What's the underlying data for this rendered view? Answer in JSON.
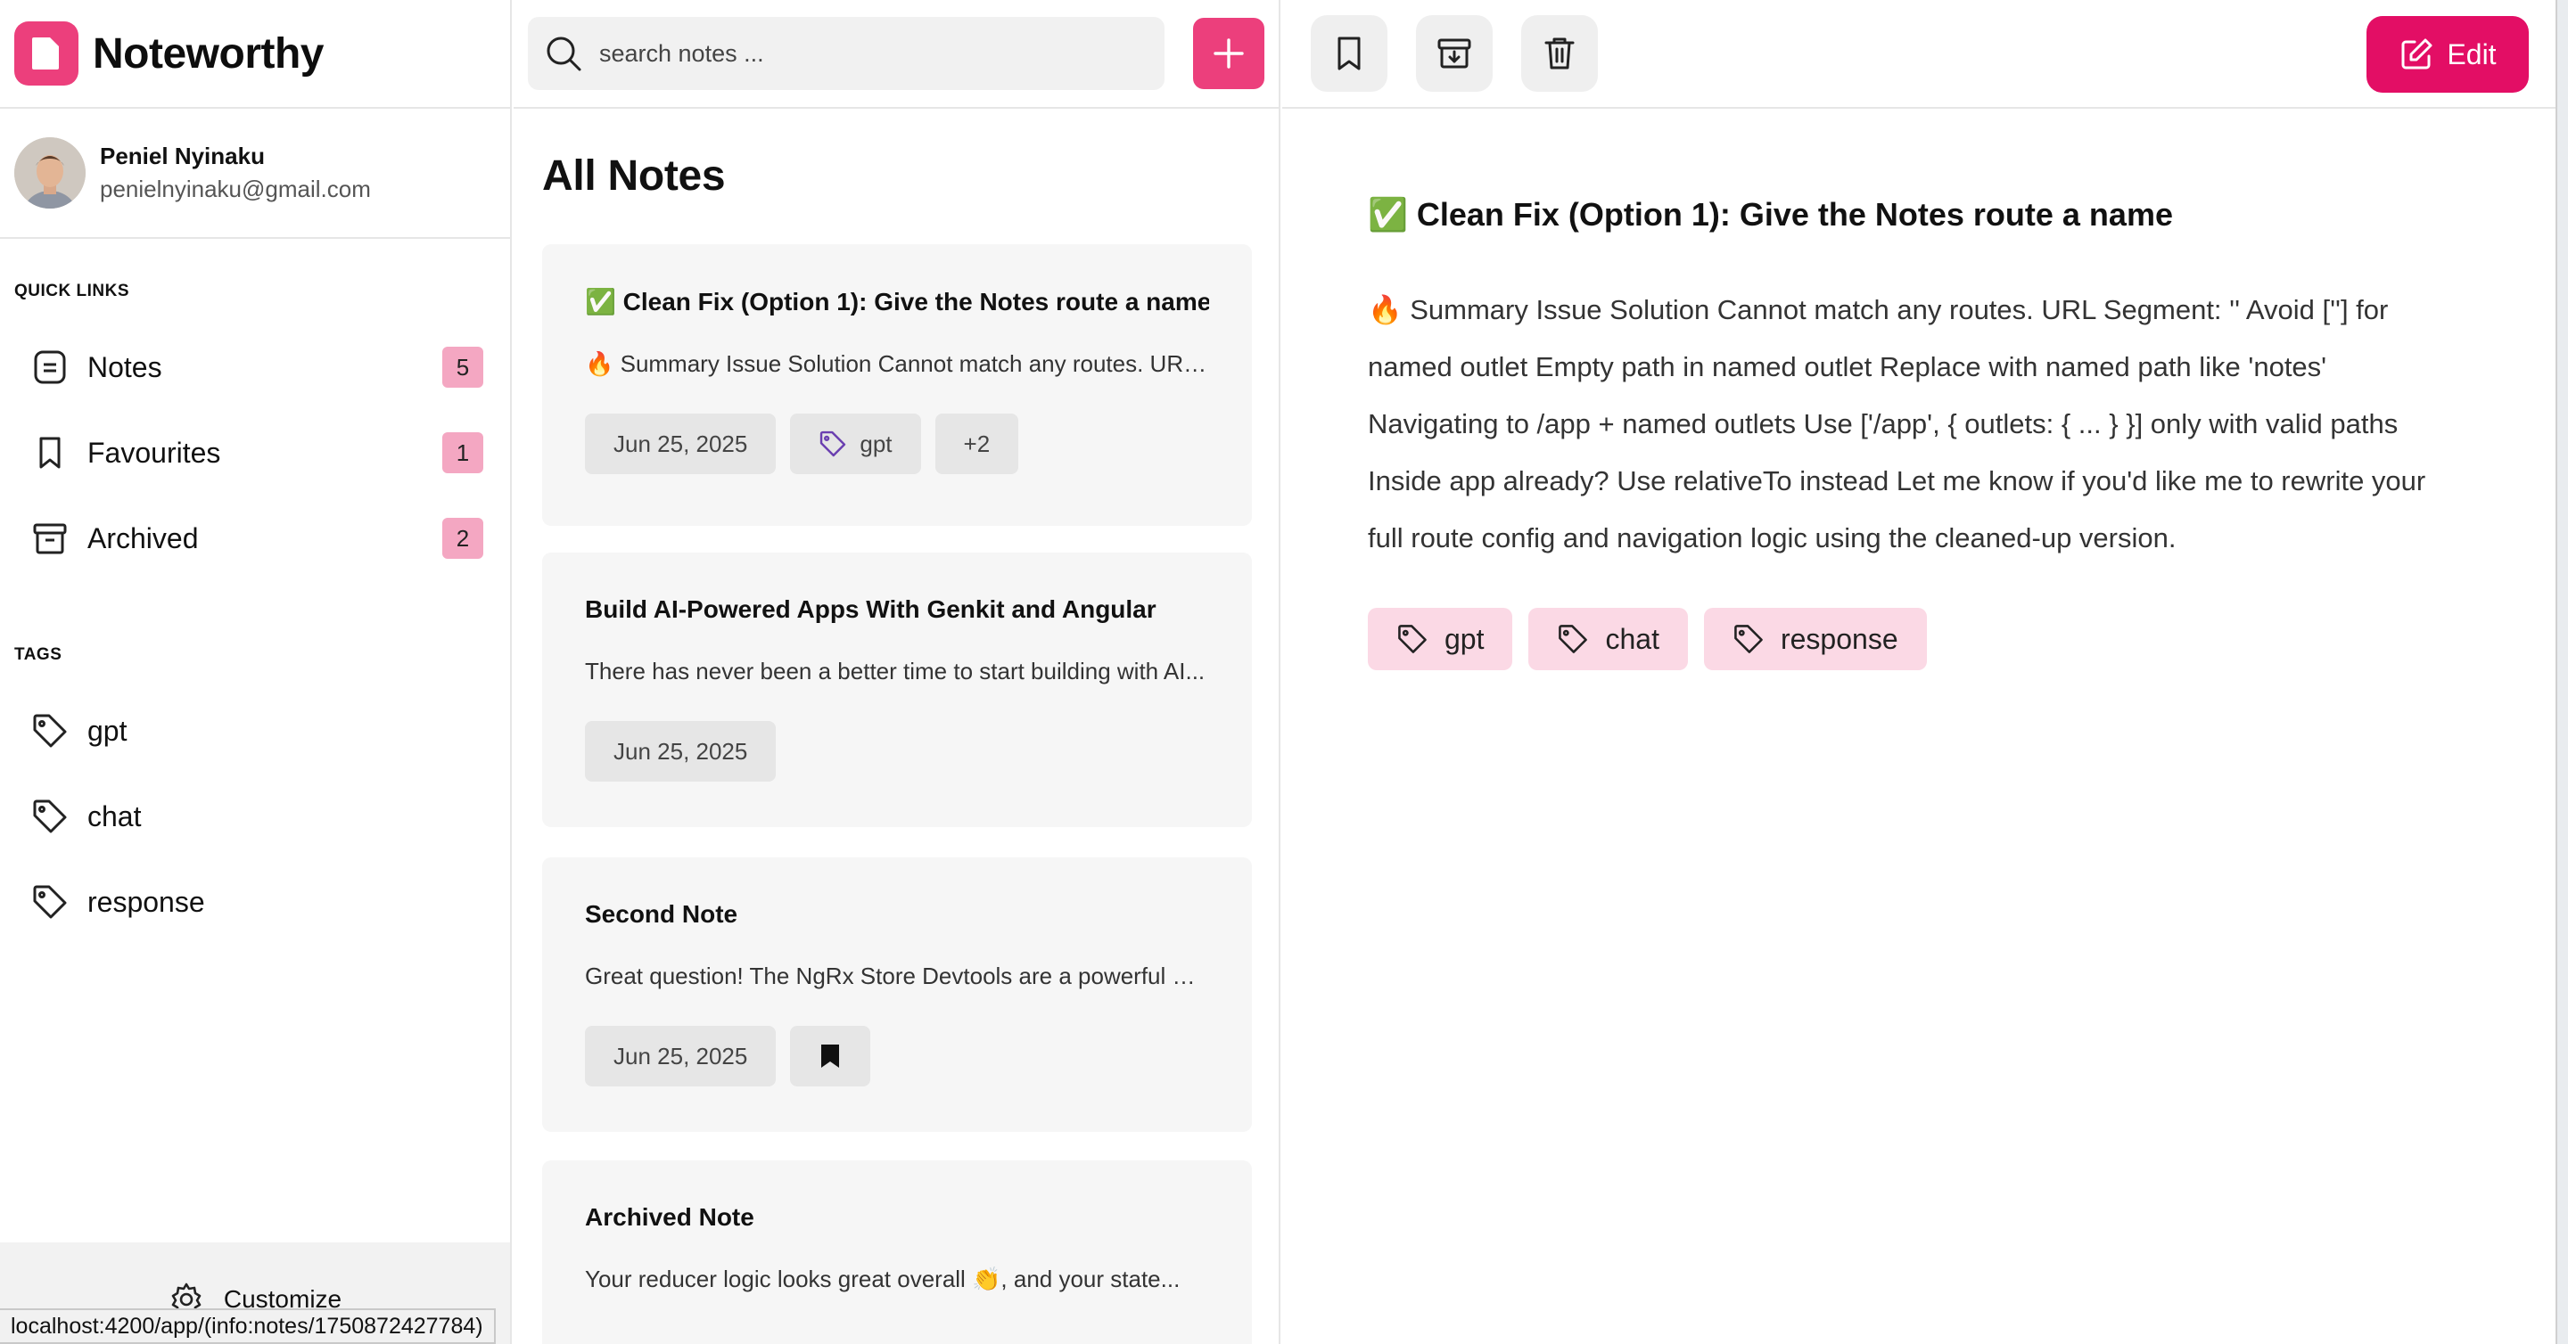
{
  "app": {
    "name": "Noteworthy",
    "brand_color": "#ec3f7c"
  },
  "profile": {
    "name": "Peniel Nyinaku",
    "email": "penielnyinaku@gmail.com"
  },
  "sidebar": {
    "quick_links_title": "QUICK LINKS",
    "quick_links": [
      {
        "label": "Notes",
        "count": "5",
        "icon": "note-icon"
      },
      {
        "label": "Favourites",
        "count": "1",
        "icon": "bookmark-icon"
      },
      {
        "label": "Archived",
        "count": "2",
        "icon": "archive-icon"
      }
    ],
    "tags_title": "TAGS",
    "tags": [
      {
        "label": "gpt"
      },
      {
        "label": "chat"
      },
      {
        "label": "response"
      }
    ],
    "customize_label": "Customize"
  },
  "status_bar": {
    "url": "localhost:4200/app/(info:notes/1750872427784)"
  },
  "search": {
    "placeholder": "search notes ..."
  },
  "list": {
    "title": "All Notes",
    "notes": [
      {
        "title": "✅ Clean Fix (Option 1): Give the Notes route a name",
        "excerpt": "🔥 Summary Issue Solution Cannot match any routes. URL...",
        "date": "Jun 25, 2025",
        "tag": "gpt",
        "more": "+2"
      },
      {
        "title": "Build AI-Powered Apps With Genkit and Angular",
        "excerpt": "There has never been a better time to start building with AI...",
        "date": "Jun 25, 2025"
      },
      {
        "title": "Second Note",
        "excerpt": "Great question! The NgRx Store Devtools are a powerful wa...",
        "date": "Jun 25, 2025",
        "favourite": true
      },
      {
        "title": "Archived Note",
        "excerpt": "Your reducer logic looks great overall 👏, and your state..."
      }
    ]
  },
  "detail": {
    "edit_label": "Edit",
    "title": "✅ Clean Fix (Option 1): Give the Notes route a name",
    "body": "🔥 Summary Issue Solution Cannot match any routes. URL Segment: '' Avoid [''] for named outlet Empty path in named outlet Replace with named path like 'notes' Navigating to /app + named outlets Use ['/app', { outlets: { ... } }] only with valid paths Inside app already? Use relativeTo instead Let me know if you'd like me to rewrite your full route config and navigation logic using the cleaned-up version.",
    "tags": [
      "gpt",
      "chat",
      "response"
    ]
  }
}
